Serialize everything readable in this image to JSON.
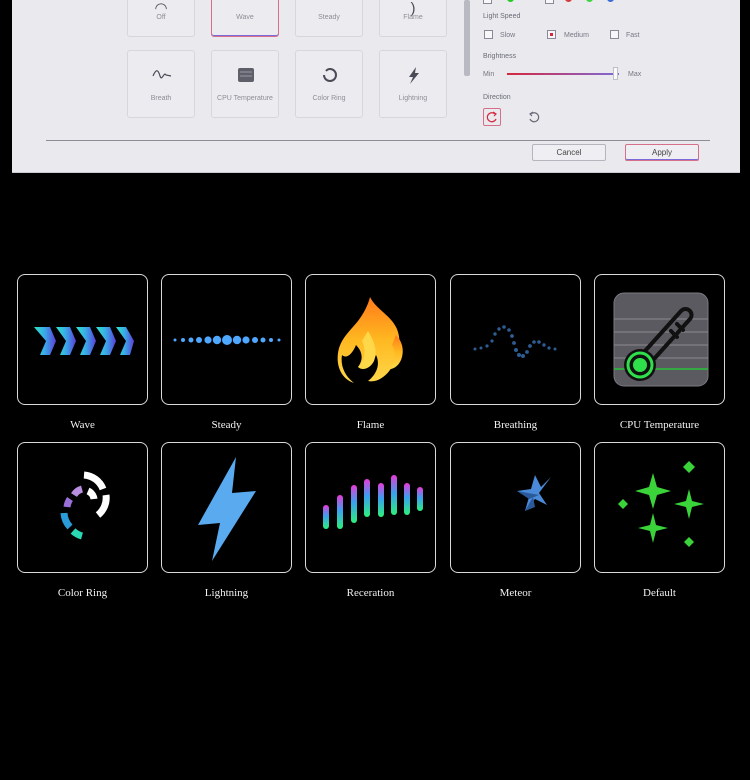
{
  "dialog": {
    "effects": [
      {
        "label": "Off",
        "icon": "off-icon"
      },
      {
        "label": "Wave",
        "icon": "wave-icon",
        "selected": true
      },
      {
        "label": "Steady",
        "icon": "steady-icon"
      },
      {
        "label": "Flame",
        "icon": "flame-icon"
      },
      {
        "label": "Breath",
        "icon": "breath-icon"
      },
      {
        "label": "CPU Temperature",
        "icon": "cpu-temperature-icon"
      },
      {
        "label": "Color Ring",
        "icon": "color-ring-icon"
      },
      {
        "label": "Lightning",
        "icon": "lightning-icon"
      }
    ],
    "light_speed": {
      "label": "Light Speed",
      "options": [
        "Slow",
        "Medium",
        "Fast"
      ],
      "selected": "Medium"
    },
    "brightness": {
      "label": "Brightness",
      "min_label": "Min",
      "max_label": "Max",
      "value_fraction": 0.97
    },
    "direction": {
      "label": "Direction",
      "options": [
        "clockwise-icon",
        "counterclockwise-icon"
      ],
      "selected": "clockwise-icon"
    },
    "swatch_colors": [
      "#cccccc",
      "#22cc22",
      "#d63a3a",
      "#3ad63a",
      "#3a6bd6"
    ],
    "buttons": {
      "cancel": "Cancel",
      "apply": "Apply"
    }
  },
  "gallery": {
    "cards": [
      {
        "label": "Wave",
        "icon": "wave-effect-icon"
      },
      {
        "label": "Steady",
        "icon": "steady-effect-icon"
      },
      {
        "label": "Flame",
        "icon": "flame-effect-icon"
      },
      {
        "label": "Breathing",
        "icon": "breathing-effect-icon"
      },
      {
        "label": "CPU Temperature",
        "icon": "cpu-temperature-effect-icon"
      },
      {
        "label": "Color Ring",
        "icon": "color-ring-effect-icon"
      },
      {
        "label": "Lightning",
        "icon": "lightning-effect-icon"
      },
      {
        "label": "Receration",
        "icon": "receration-effect-icon"
      },
      {
        "label": "Meteor",
        "icon": "meteor-effect-icon"
      },
      {
        "label": "Default",
        "icon": "default-effect-icon"
      }
    ]
  },
  "colors": {
    "accent_pink": "#d6708a",
    "accent_purple": "#7d6ad8",
    "checkbox_red": "#d6273d",
    "gallery_bg": "#000000",
    "card_border": "#d9d9d9"
  }
}
